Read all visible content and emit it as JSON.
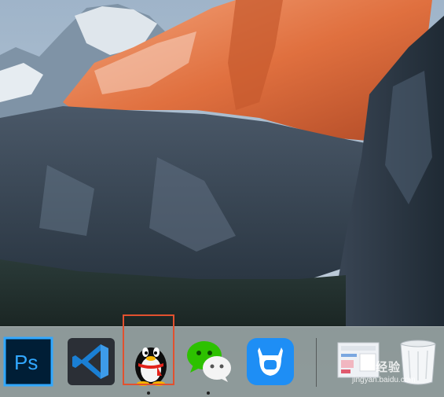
{
  "dock": {
    "apps": [
      {
        "name": "Photoshop",
        "icon": "photoshop-icon",
        "label": "Ps"
      },
      {
        "name": "Visual Studio Code",
        "icon": "vscode-icon"
      },
      {
        "name": "QQ",
        "icon": "qq-penguin-icon",
        "highlighted": true
      },
      {
        "name": "WeChat",
        "icon": "wechat-icon"
      },
      {
        "name": "Docker/QQ Music style blue app",
        "icon": "blue-cow-icon"
      },
      {
        "name": "Document thumbnail",
        "icon": "document-thumbnail-icon"
      },
      {
        "name": "Trash",
        "icon": "trash-icon"
      }
    ]
  },
  "watermark": {
    "main_text": "经验",
    "url_text": "jingyan.baidu.com"
  },
  "colors": {
    "highlight_border": "#e2512f",
    "photoshop_bg": "#001e36",
    "photoshop_accent": "#31a8ff",
    "wechat_green": "#2dc100",
    "blue_app_bg": "#1e8ef5"
  }
}
